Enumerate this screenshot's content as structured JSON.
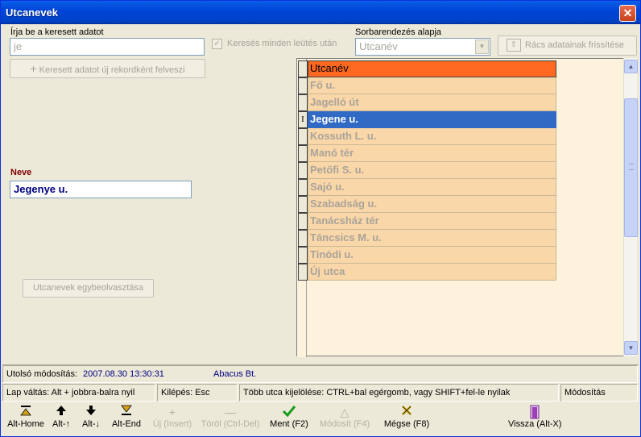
{
  "window": {
    "title": "Utcanevek",
    "close_glyph": "✕"
  },
  "search": {
    "label": "Írja be a keresett adatot",
    "value": "je"
  },
  "search_each_key": {
    "label": "Keresés minden leütés után",
    "checked": true
  },
  "sort": {
    "label": "Sorbarendezés alapja",
    "value": "Utcanév"
  },
  "refresh_button": "Rács adatainak frissítése",
  "add_new_record_button": "Keresett adatot új rekordként felveszi",
  "name_field": {
    "label": "Neve",
    "value": "Jegenye u."
  },
  "merge_button": "Utcanevek egybeolvasztása",
  "grid": {
    "header": "Utcanév",
    "rows": [
      "Fő u.",
      "Jagelló út",
      "Jegene u.",
      "Kossuth L. u.",
      "Manó tér",
      "Petőfi S. u.",
      "Sajó u.",
      "Szabadság u.",
      "Tanácsház tér",
      "Táncsics M. u.",
      "Tinódi u.",
      "Új utca"
    ],
    "selected_index": 2,
    "cursor_glyph": "I"
  },
  "status": {
    "last_modified_label": "Utolsó módosítás:",
    "last_modified_value": "2007.08.30 13:30:31",
    "company": "Abacus Bt."
  },
  "hints": {
    "page_switch": "Lap váltás: Alt + jobbra-balra nyil",
    "exit": "Kilépés: Esc",
    "multi_select": "Több utca kijelölése: CTRL+bal egérgomb, vagy SHIFT+fel-le nyilak",
    "mode": "Módosítás"
  },
  "toolbar": {
    "home": "Alt-Home",
    "up": "Alt-↑",
    "down": "Alt-↓",
    "end": "Alt-End",
    "insert": "Új (Insert)",
    "delete": "Töröl (Ctrl-Del)",
    "save": "Ment (F2)",
    "modify": "Módosít (F4)",
    "cancel": "Mégse (F8)",
    "back": "Vissza (Alt-X)"
  },
  "icons": {
    "home": "first-record-icon",
    "up": "up-arrow-icon",
    "down": "down-arrow-icon",
    "end": "last-record-icon",
    "insert": "plus-icon",
    "delete": "minus-icon",
    "save": "checkmark-icon",
    "modify": "triangle-up-icon",
    "cancel": "x-icon",
    "back": "exit-door-icon"
  },
  "colors": {
    "title_bar": "#0046d8",
    "grid_header": "#fe6820",
    "grid_row": "#fad7a8",
    "selection": "#316ac5",
    "name_label": "#800000",
    "status_value": "#000080"
  }
}
